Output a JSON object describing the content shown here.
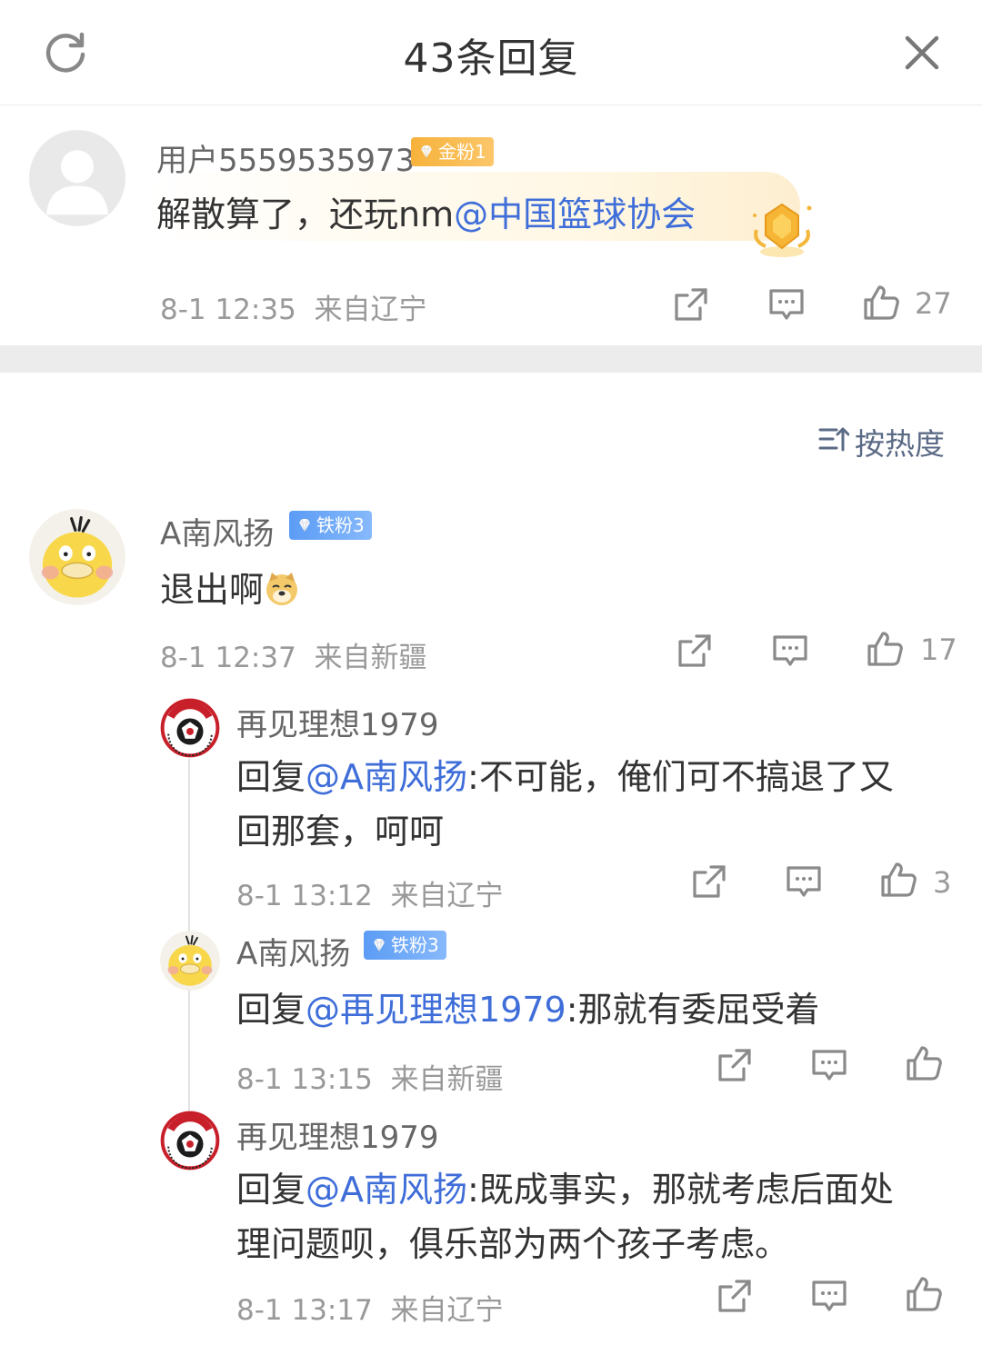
{
  "header": {
    "title": "43条回复",
    "refresh_icon": "refresh-icon",
    "close_icon": "close-icon"
  },
  "main_comment": {
    "user": "用户5559535973",
    "badge": "金粉1",
    "text_prefix": "解散算了，还玩nm",
    "mention": "@中国篮球协会",
    "time": "8-1 12:35",
    "location": "来自辽宁",
    "likes": "27"
  },
  "sort": {
    "label": "按热度"
  },
  "replies": [
    {
      "user": "A南风扬",
      "badge": "铁粉3",
      "text": "退出啊",
      "emoji": "doge-emoji",
      "time": "8-1 12:37",
      "location": "来自新疆",
      "likes": "17"
    }
  ],
  "sub_replies": [
    {
      "user": "再见理想1979",
      "reply_prefix": "回复",
      "mention": "@A南风扬",
      "line1": ":不可能，俺们可不搞退了又",
      "line2": "回那套，呵呵",
      "time": "8-1 13:12",
      "location": "来自辽宁",
      "likes": "3"
    },
    {
      "user": "A南风扬",
      "badge": "铁粉3",
      "reply_prefix": "回复",
      "mention": "@再见理想1979",
      "line1": ":那就有委屈受着",
      "time": "8-1 13:15",
      "location": "来自新疆"
    },
    {
      "user": "再见理想1979",
      "reply_prefix": "回复",
      "mention": "@A南风扬",
      "line1": ":既成事实，那就考虑后面处",
      "line2": "理问题呗，俱乐部为两个孩子考虑。",
      "time": "8-1 13:17",
      "location": "来自辽宁"
    }
  ],
  "colors": {
    "mention": "#3f6ed9",
    "gold_badge": "#f7b23b",
    "iron_badge": "#5b9cf5",
    "meta_text": "#999999"
  }
}
